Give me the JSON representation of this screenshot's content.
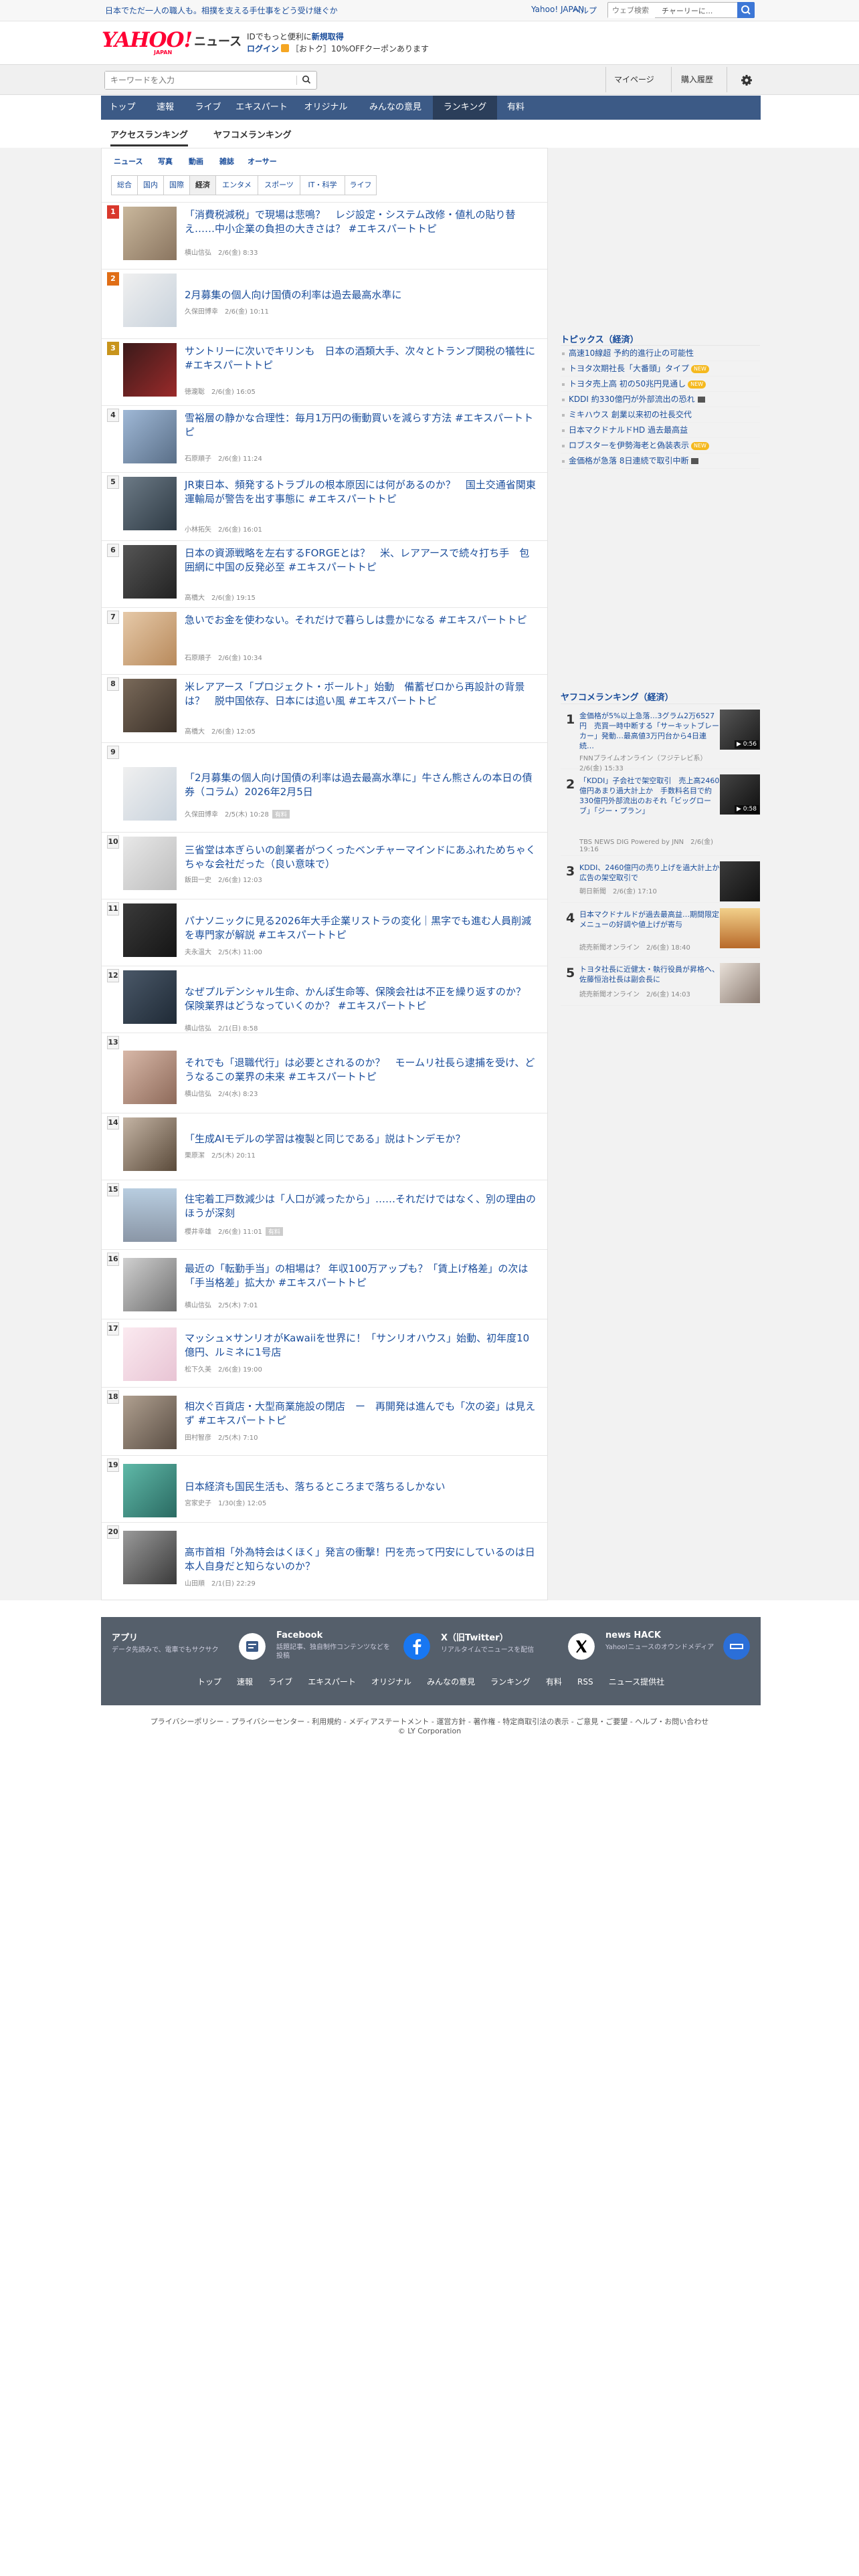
{
  "topbar": {
    "promo_text": "日本でただ一人の職人も。相撲を支える手仕事をどう受け継ぐか",
    "yahoo_japan_link": "Yahoo! JAPAN",
    "help_link": "ヘルプ",
    "web_search_placeholder": "ウェブ検索",
    "web_search_hint": "チャーリーに..."
  },
  "header": {
    "logo_text": "YAHOO!",
    "logo_sub": "JAPAN",
    "service_name": "ニュース",
    "register_line": "IDでもっと便利に",
    "register_link": "新規取得",
    "login_link": "ログイン",
    "coupon_text": "［おトク］10%OFFクーポンあります"
  },
  "search": {
    "keyword_placeholder": "キーワードを入力",
    "mypage_label": "マイページ",
    "history_label": "購入履歴"
  },
  "global_nav": [
    {
      "label": "トップ",
      "active": false
    },
    {
      "label": "速報",
      "active": false
    },
    {
      "label": "ライブ",
      "active": false
    },
    {
      "label": "エキスパート",
      "active": false
    },
    {
      "label": "オリジナル",
      "active": false
    },
    {
      "label": "みんなの意見",
      "active": false
    },
    {
      "label": "ランキング",
      "active": true
    },
    {
      "label": "有料",
      "active": false
    }
  ],
  "sub_tabs": [
    {
      "label": "アクセスランキング",
      "active": true
    },
    {
      "label": "ヤフコメランキング",
      "active": false
    }
  ],
  "media_tabs": [
    "ニュース",
    "写真",
    "動画",
    "雑誌",
    "オーサー"
  ],
  "category_tabs": [
    {
      "label": "総合",
      "active": false
    },
    {
      "label": "国内",
      "active": false
    },
    {
      "label": "国際",
      "active": false
    },
    {
      "label": "経済",
      "active": true
    },
    {
      "label": "エンタメ",
      "active": false
    },
    {
      "label": "スポーツ",
      "active": false
    },
    {
      "label": "IT・科学",
      "active": false
    },
    {
      "label": "ライフ",
      "active": false
    }
  ],
  "ranking": [
    {
      "rank": "1",
      "title": "「消費税減税」で現場は悲鳴？　レジ設定・システム改修・値札の貼り替え……中小企業の負担の大きさは？ #エキスパートトピ",
      "meta": "横山信弘　2/6(金) 8:33",
      "label": ""
    },
    {
      "rank": "2",
      "title": "2月募集の個人向け国債の利率は過去最高水準に",
      "meta": "久保田博幸　2/6(金) 10:11",
      "label": ""
    },
    {
      "rank": "3",
      "title": "サントリーに次いでキリンも　日本の酒類大手、次々とトランプ関税の犠牲に #エキスパートトピ",
      "meta": "徳瀧聡　2/6(金) 16:05",
      "label": ""
    },
    {
      "rank": "4",
      "title": "雪裕層の静かな合理性：毎月1万円の衝動買いを減らす方法 #エキスパートトピ",
      "meta": "石原順子　2/6(金) 11:24",
      "label": ""
    },
    {
      "rank": "5",
      "title": "JR東日本、頻発するトラブルの根本原因には何があるのか？　国土交通省関東運輸局が警告を出す事態に #エキスパートトピ",
      "meta": "小林拓矢　2/6(金) 16:01",
      "label": ""
    },
    {
      "rank": "6",
      "title": "日本の資源戦略を左右するFORGEとは？　米、レアアースで続々打ち手　包囲網に中国の反発必至 #エキスパートトピ",
      "meta": "高橋大　2/6(金) 19:15",
      "label": ""
    },
    {
      "rank": "7",
      "title": "急いでお金を使わない。それだけで暮らしは豊かになる #エキスパートトピ",
      "meta": "石原順子　2/6(金) 10:34",
      "label": ""
    },
    {
      "rank": "8",
      "title": "米レアアース「プロジェクト・ボールト」始動　備蓄ゼロから再設計の背景は？　脱中国依存、日本には追い風 #エキスパートトピ",
      "meta": "高橋大　2/6(金) 12:05",
      "label": ""
    },
    {
      "rank": "9",
      "title": "「2月募集の個人向け国債の利率は過去最高水準に」牛さん熊さんの本日の債券（コラム）2026年2月5日",
      "meta": "久保田博幸　2/5(木) 10:28",
      "label": "有料"
    },
    {
      "rank": "10",
      "title": "三省堂は本ぎらいの創業者がつくったベンチャーマインドにあふれためちゃくちゃな会社だった（良い意味で）",
      "meta": "飯田一史　2/6(金) 12:03",
      "label": ""
    },
    {
      "rank": "11",
      "title": "パナソニックに見る2026年大手企業リストラの変化｜黒字でも進む人員削減を専門家が解説 #エキスパートトピ",
      "meta": "夫永温大　2/5(木) 11:00",
      "label": ""
    },
    {
      "rank": "12",
      "title": "なぜプルデンシャル生命、かんぽ生命等、保険会社は不正を繰り返すのか？ 保険業界はどうなっていくのか？ #エキスパートトピ",
      "meta": "横山信弘　2/1(日) 8:58",
      "label": ""
    },
    {
      "rank": "13",
      "title": "それでも「退職代行」は必要とされるのか？　モームリ社長ら逮捕を受け、どうなるこの業界の未来 #エキスパートトピ",
      "meta": "横山信弘　2/4(水) 8:23",
      "label": ""
    },
    {
      "rank": "14",
      "title": "「生成AIモデルの学習は複製と同じである」説はトンデモか？",
      "meta": "栗原潔　2/5(木) 20:11",
      "label": ""
    },
    {
      "rank": "15",
      "title": "住宅着工戸数減少は「人口が減ったから」……それだけではなく、別の理由のほうが深刻",
      "meta": "櫻井幸雄　2/6(金) 11:01",
      "label": "有料"
    },
    {
      "rank": "16",
      "title": "最近の「転勤手当」の相場は？ 年収100万アップも？「賃上げ格差」の次は「手当格差」拡大か #エキスパートトピ",
      "meta": "横山信弘　2/5(木) 7:01",
      "label": ""
    },
    {
      "rank": "17",
      "title": "マッシュ×サンリオがKawaiiを世界に！「サンリオハウス」始動、初年度10億円、ルミネに1号店",
      "meta": "松下久美　2/6(金) 19:00",
      "label": ""
    },
    {
      "rank": "18",
      "title": "相次ぐ百貨店・大型商業施設の閉店　ー　再開発は進んでも「次の姿」は見えず #エキスパートトピ",
      "meta": "田村智彦　2/5(木) 7:10",
      "label": ""
    },
    {
      "rank": "19",
      "title": "日本経済も国民生活も、落ちるところまで落ちるしかない",
      "meta": "宮家史子　1/30(金) 12:05",
      "label": ""
    },
    {
      "rank": "20",
      "title": "高市首相「外為特会はくほく」発言の衝撃！円を売って円安にしているのは日本人自身だと知らないのか？",
      "meta": "山田順　2/1(日) 22:29",
      "label": ""
    }
  ],
  "topics": {
    "heading": "トピックス（経済）",
    "items": [
      {
        "text": "高速10線超 予約的進行止の可能性",
        "badge": "",
        "video": false
      },
      {
        "text": "トヨタ次期社長「大番頭」タイプ",
        "badge": "NEW",
        "video": false
      },
      {
        "text": "トヨタ売上高 初の50兆円見通し",
        "badge": "NEW",
        "video": false
      },
      {
        "text": "KDDI 約330億円が外部流出の恐れ",
        "badge": "",
        "video": true
      },
      {
        "text": "ミキハウス 創業以来初の社長交代",
        "badge": "",
        "video": false
      },
      {
        "text": "日本マクドナルドHD 過去最高益",
        "badge": "",
        "video": false
      },
      {
        "text": "ロブスターを伊勢海老と偽装表示",
        "badge": "NEW",
        "video": false
      },
      {
        "text": "金価格が急落 8日連続で取引中断",
        "badge": "",
        "video": true
      }
    ]
  },
  "comment_ranking": {
    "heading": "ヤフコメランキング（経済）",
    "items": [
      {
        "rank": "1",
        "title": "金価格が5%以上急落…3グラム2万6527円　売買一時中断する「サーキットブレーカー」発動…最高値3万円台から4日連続…",
        "source": "FNNプライムオンライン（フジテレビ系）　2/6(金) 15:33",
        "duration": "0:56"
      },
      {
        "rank": "2",
        "title": "「KDDI」子会社で架空取引　売上高2460億円あまり過大計上か　手数料名目で約330億円外部流出のおそれ「ビッグローブ」「ジー・プラン」",
        "source": "TBS NEWS DIG Powered by JNN　2/6(金) 19:16",
        "duration": "0:58"
      },
      {
        "rank": "3",
        "title": "KDDI、2460億円の売り上げを過大計上か　広告の架空取引で",
        "source": "朝日新聞　2/6(金) 17:10",
        "duration": ""
      },
      {
        "rank": "4",
        "title": "日本マクドナルドが過去最高益…期間限定メニューの好調や値上げが寄与",
        "source": "読売新聞オンライン　2/6(金) 18:40",
        "duration": ""
      },
      {
        "rank": "5",
        "title": "トヨタ社長に近健太・執行役員が昇格へ、佐藤恒治社長は副会長に",
        "source": "読売新聞オンライン　2/6(金) 14:03",
        "duration": ""
      }
    ]
  },
  "footer": {
    "apps": [
      {
        "title": "アプリ",
        "desc": "データ先読みで、電車でもサクサク"
      },
      {
        "title": "Facebook",
        "desc": "話題記事、独自制作コンテンツなどを投稿"
      },
      {
        "title": "X（旧Twitter）",
        "desc": "リアルタイムでニュースを配信"
      },
      {
        "title": "news HACK",
        "desc": "Yahoo!ニュースのオウンドメディア"
      }
    ],
    "links": [
      "トップ",
      "速報",
      "ライブ",
      "エキスパート",
      "オリジナル",
      "みんなの意見",
      "ランキング",
      "有料",
      "RSS",
      "ニュース提供社"
    ],
    "legal": "プライバシーポリシー - プライバシーセンター - 利用規約 - メディアステートメント - 運営方針 - 著作権 - 特定商取引法の表示 - ご意見・ご要望 - ヘルプ・お問い合わせ",
    "copyright": "© LY Corporation"
  },
  "colors": {
    "link": "#1a4d9b",
    "nav_bg": "#3c5a86",
    "nav_active": "#2b3e5a",
    "footer_bg": "#555f6b",
    "rank1": "#d9382c",
    "rank2": "#e06e16",
    "rank3": "#c8941c"
  }
}
